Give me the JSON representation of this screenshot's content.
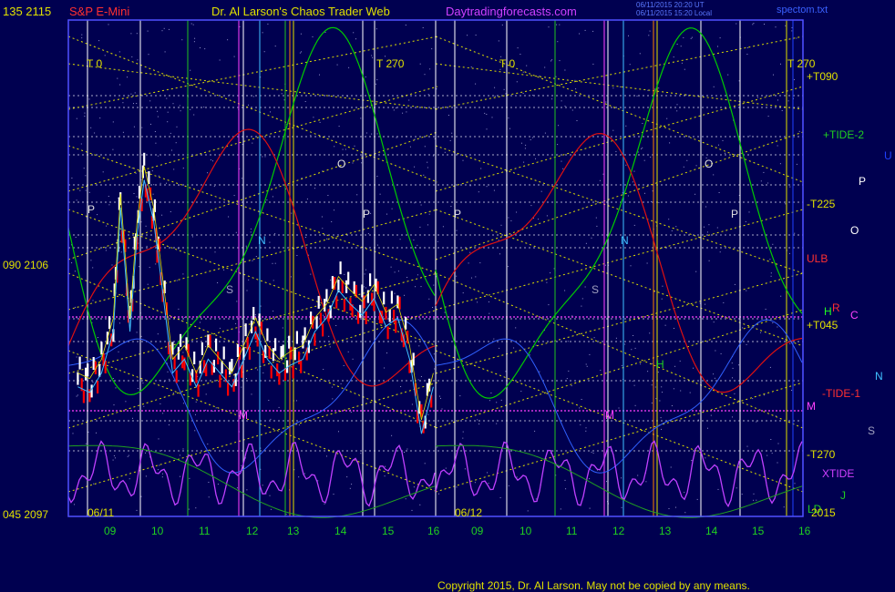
{
  "header": {
    "scale_top": "135  2115",
    "instrument": "S&P E-Mini",
    "author": "Dr. Al Larson's Chaos Trader Web",
    "site": "Daytradingforecasts.com",
    "stamp1": "06/11/2015 20:20 UT",
    "stamp2": "06/11/2015 15:20 Local",
    "file": "spectom.txt"
  },
  "left_axis": {
    "top": "135  2115",
    "mid": "090  2106",
    "bottom": "045  2097"
  },
  "footer": {
    "copyright": "Copyright 2015, Dr. Al Larson. May not be copied by any means."
  },
  "colors": {
    "background": "#000050",
    "frame": "#5050ff",
    "price_up": "#ffffff",
    "price_down": "#ff0000",
    "tide2": "#00cc00",
    "ulb": "#e01010",
    "xtide": "#c040ff",
    "grid_yellow": "#e0e000",
    "cyan": "#40c0ff",
    "magenta": "#ff40ff"
  },
  "chart_data": [
    {
      "type": "line",
      "panel": "06/11",
      "date_label": "06/11",
      "x_ticks": [
        "09",
        "10",
        "11",
        "12",
        "13",
        "14",
        "15",
        "16"
      ],
      "y_range": [
        2097,
        2115
      ],
      "y_ticks": [
        2097,
        2106,
        2115
      ],
      "time_markers": [
        "T   0",
        "T   270"
      ],
      "series": [
        {
          "name": "price",
          "hours": [
            8.5,
            8.75,
            9.0,
            9.25,
            9.4,
            9.6,
            9.75,
            9.9,
            10.1,
            10.25,
            10.5,
            10.75,
            11.0,
            11.25,
            11.5,
            11.75,
            12.0,
            12.25,
            12.5,
            12.75,
            13.0,
            13.25,
            13.5,
            13.75,
            14.0,
            14.25,
            14.5,
            14.75,
            15.0,
            15.25,
            15.5,
            15.75,
            16.0
          ],
          "values": [
            2102.0,
            2101.8,
            2102.5,
            2104.0,
            2108.5,
            2104.0,
            2107.5,
            2109.5,
            2108.0,
            2106.0,
            2102.5,
            2103.0,
            2102.0,
            2103.0,
            2102.5,
            2102.0,
            2103.0,
            2104.0,
            2103.0,
            2102.5,
            2102.8,
            2103.0,
            2104.0,
            2104.5,
            2105.5,
            2105.0,
            2104.6,
            2105.2,
            2104.2,
            2104.5,
            2103.0,
            2100.3,
            2102.0
          ]
        }
      ]
    },
    {
      "type": "line",
      "panel": "06/12",
      "date_label": "06/12",
      "x_ticks": [
        "09",
        "10",
        "11",
        "12",
        "13",
        "14",
        "15",
        "16"
      ],
      "time_markers": [
        "T   0",
        "T   270"
      ]
    }
  ],
  "marker_labels": {
    "left_panel": [
      "P",
      "O",
      "P",
      "N",
      "S",
      "M"
    ],
    "right_panel": [
      "P",
      "S",
      "N",
      "O",
      "P",
      "M",
      "H"
    ]
  },
  "right_labels": {
    "t090": "+T090",
    "tide2": "+TIDE-2",
    "u": "U",
    "p": "P",
    "t225": "-T225",
    "o": "O",
    "ulb": "ULB",
    "h": "H",
    "r": "R",
    "c": "C",
    "t045": "+T045",
    "n": "N",
    "tide1": "-TIDE-1",
    "m": "M",
    "s": "S",
    "t270": "-T270",
    "xtide": "XTIDE",
    "j": "J",
    "ld": "LD",
    "v2015": "2015"
  }
}
